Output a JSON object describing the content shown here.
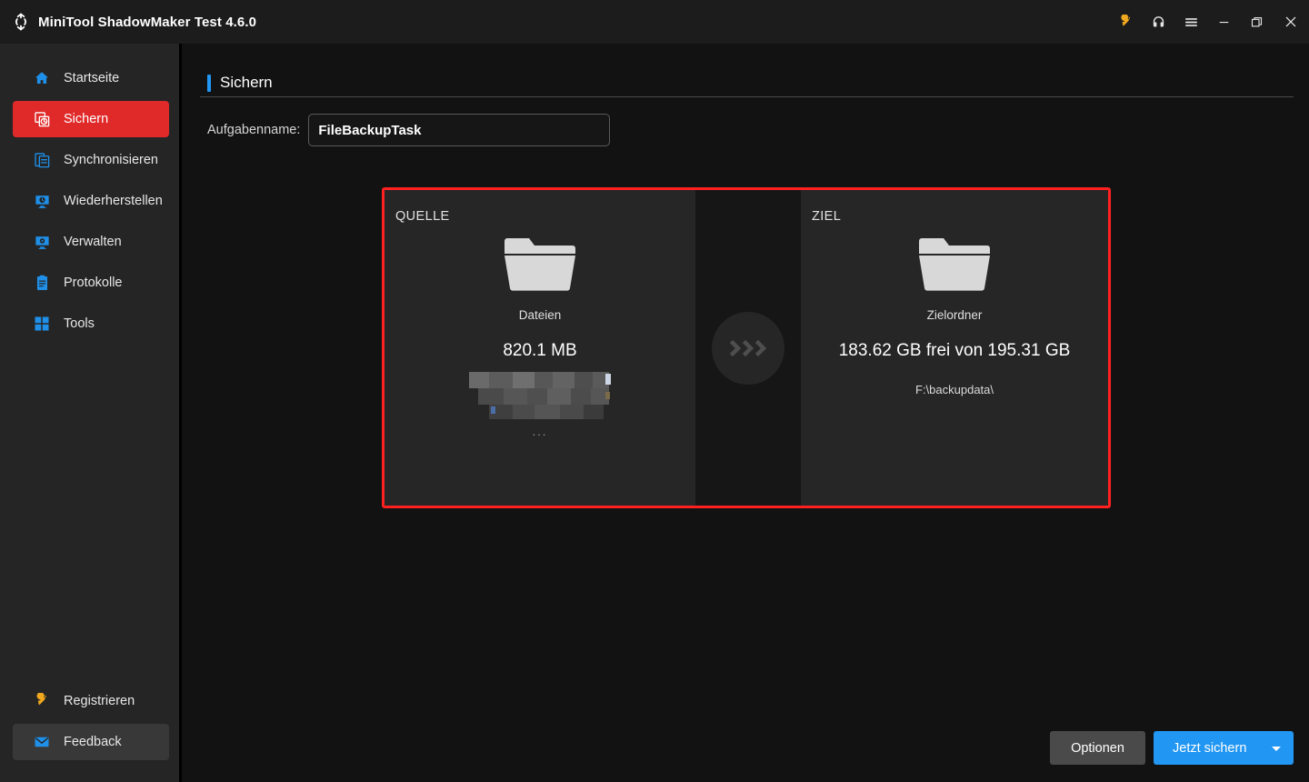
{
  "titlebar": {
    "logo_icon": "minitool-refresh-logo",
    "title": "MiniTool ShadowMaker Test 4.6.0",
    "actions": [
      {
        "name": "key-icon",
        "label": ""
      },
      {
        "name": "headset-icon",
        "label": ""
      },
      {
        "name": "hamburger-menu-icon",
        "label": ""
      },
      {
        "name": "minimize-icon",
        "label": ""
      },
      {
        "name": "restore-icon",
        "label": ""
      },
      {
        "name": "close-icon",
        "label": ""
      }
    ]
  },
  "sidebar": {
    "items": [
      {
        "id": "home",
        "label": "Startseite",
        "icon": "home-icon",
        "active": false
      },
      {
        "id": "backup",
        "label": "Sichern",
        "icon": "backup-icon",
        "active": true
      },
      {
        "id": "sync",
        "label": "Synchronisieren",
        "icon": "sync-icon",
        "active": false
      },
      {
        "id": "restore",
        "label": "Wiederherstellen",
        "icon": "restore-icon",
        "active": false
      },
      {
        "id": "manage",
        "label": "Verwalten",
        "icon": "manage-icon",
        "active": false
      },
      {
        "id": "logs",
        "label": "Protokolle",
        "icon": "logs-icon",
        "active": false
      },
      {
        "id": "tools",
        "label": "Tools",
        "icon": "tools-icon",
        "active": false
      }
    ],
    "bottom_items": [
      {
        "id": "register",
        "label": "Registrieren",
        "icon": "key-icon",
        "highlighted": false
      },
      {
        "id": "feedback",
        "label": "Feedback",
        "icon": "mail-icon",
        "highlighted": true
      }
    ]
  },
  "page": {
    "title": "Sichern",
    "task": {
      "label": "Aufgabenname:",
      "value": "FileBackupTask",
      "placeholder": "Aufgabenname"
    }
  },
  "panels": {
    "border_color": "#ff2020",
    "source": {
      "title": "QUELLE",
      "icon": "folder-icon",
      "kind": "Dateien",
      "size": "820.1 MB",
      "path_redacted": true,
      "path_ellipsis": "..."
    },
    "connector": {
      "icon": "triple-chevron-right-icon"
    },
    "destination": {
      "title": "ZIEL",
      "icon": "folder-icon",
      "kind": "Zielordner",
      "size": "183.62 GB frei von 195.31 GB",
      "path": "F:\\backupdata\\"
    }
  },
  "footer": {
    "options_label": "Optionen",
    "backup_label": "Jetzt sichern",
    "backup_caret": "chevron-down-icon"
  },
  "colors": {
    "accent_blue": "#2196f3",
    "accent_red": "#e02a2a",
    "highlight_red": "#ff2020",
    "gold": "#f0a81e",
    "window_bg": "#121212",
    "sidebar_bg": "#252525",
    "panel_bg": "#262626"
  }
}
